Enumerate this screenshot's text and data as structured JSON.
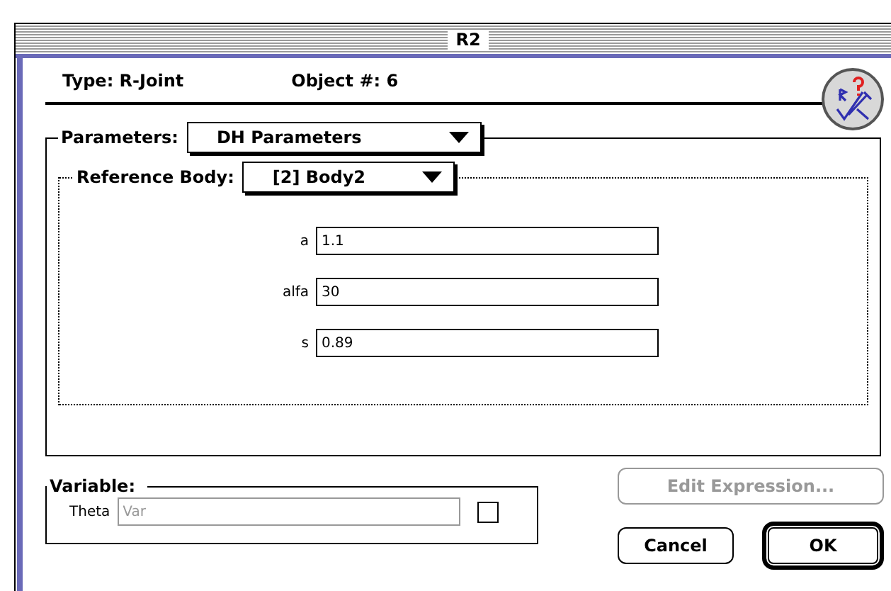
{
  "window": {
    "title": "R2"
  },
  "header": {
    "type_label": "Type: R-Joint",
    "object_label": "Object #: 6"
  },
  "parameters": {
    "label": "Parameters:",
    "selection": "DH Parameters"
  },
  "reference_body": {
    "label": "Reference Body:",
    "selection": "[2] Body2"
  },
  "fields": [
    {
      "label": "a",
      "value": "1.1"
    },
    {
      "label": "alfa",
      "value": "30"
    },
    {
      "label": "s",
      "value": "0.89"
    }
  ],
  "variable": {
    "label": "Variable:",
    "field_label": "Theta",
    "value": "Var",
    "disabled": true,
    "checked": false
  },
  "buttons": [
    {
      "label": "Edit Expression...",
      "disabled": true,
      "default": false
    },
    {
      "label": "Cancel",
      "disabled": false,
      "default": false
    },
    {
      "label": "OK",
      "disabled": false,
      "default": true
    }
  ]
}
